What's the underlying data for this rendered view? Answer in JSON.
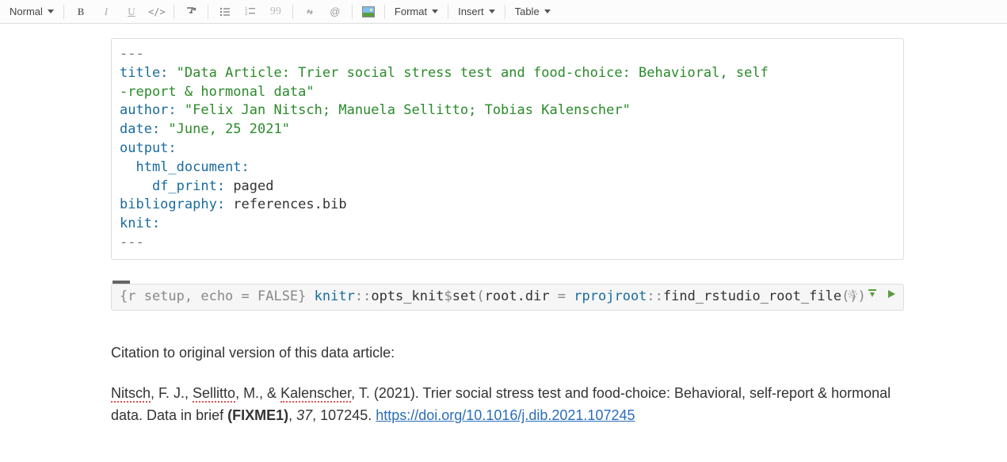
{
  "toolbar": {
    "style_dropdown": "Normal",
    "format_menu": "Format",
    "insert_menu": "Insert",
    "table_menu": "Table"
  },
  "yaml": {
    "dash": "---",
    "title_key": "title:",
    "title_val_line1": " \"Data Article: Trier social stress test and food-choice: Behavioral, self",
    "title_val_line2": "-report & hormonal data\"",
    "author_key": "author:",
    "author_val": " \"Felix Jan Nitsch; Manuela Sellitto; Tobias Kalenscher\"",
    "date_key": "date:",
    "date_val": " \"June, 25 2021\"",
    "output_key": "output:",
    "html_doc_key": "  html_document:",
    "df_print_key": "    df_print:",
    "df_print_val": " paged",
    "biblio_key": "bibliography:",
    "biblio_val": " references.bib",
    "knit_key": "knit:"
  },
  "chunk": {
    "header": "{r setup, echo = FALSE}",
    "ns1": "knitr",
    "op1": "::",
    "id1": "opts_knit",
    "op2": "$",
    "fn1": "set",
    "paren_open": "(",
    "arg1": "root.dir ",
    "eq": "=",
    "sp": " ",
    "ns2": "rprojroot",
    "op3": "::",
    "fn2": "find_rstudio_root_file",
    "paren2": "()",
    "paren_close": ")"
  },
  "prose": {
    "intro": "Citation to original version of this data article:",
    "cite_name1": "Nitsch",
    "cite_seg1": ", F. J., ",
    "cite_name2": "Sellitto",
    "cite_seg2": ", M., & ",
    "cite_name3": "Kalenscher",
    "cite_seg3": ", T. (2021). Trier social stress test and food-choice: Behavioral, self-report & hormonal data. Data in brief ",
    "fixme": "(FIXME1)",
    "cite_seg4": ", ",
    "vol": "37",
    "cite_seg5": ", 107245. ",
    "doi": "https://doi.org/10.1016/j.dib.2021.107245"
  }
}
